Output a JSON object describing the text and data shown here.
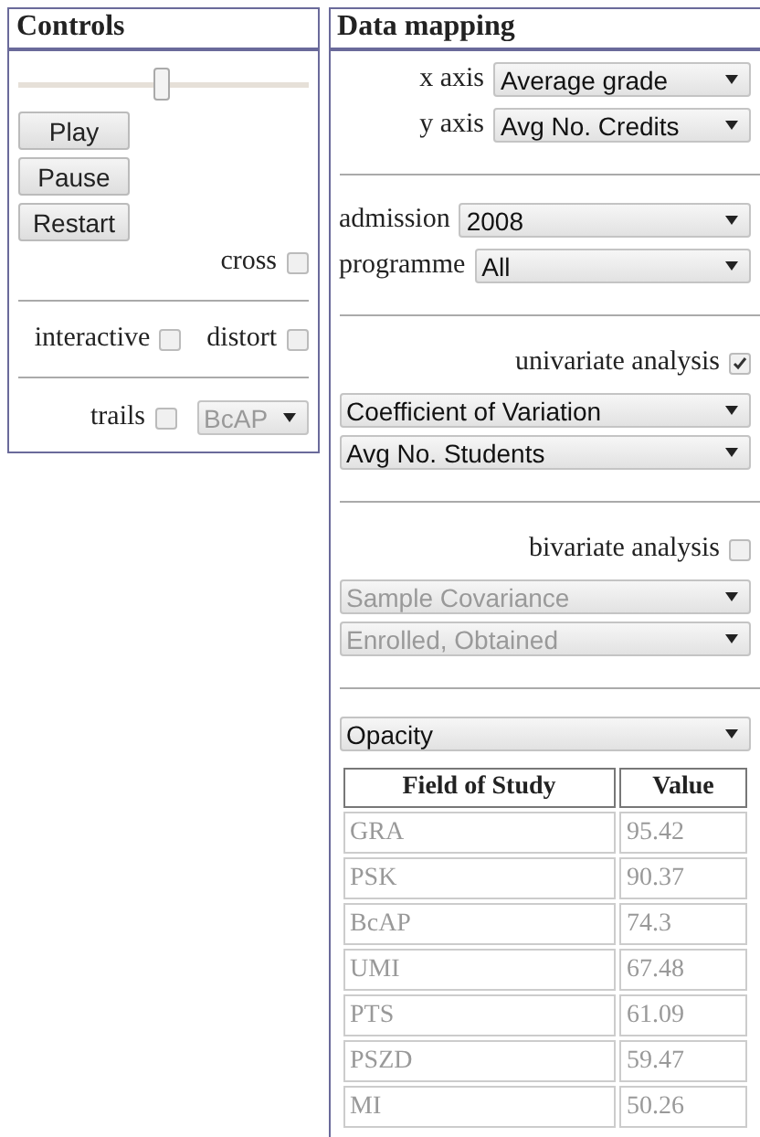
{
  "controls": {
    "title": "Controls",
    "slider": {
      "level": 0.5
    },
    "buttons": [
      "Play",
      "Pause",
      "Restart"
    ],
    "cross": {
      "label": "cross",
      "checked": false
    },
    "interactive": {
      "label": "interactive",
      "checked": false
    },
    "distort": {
      "label": "distort",
      "checked": false
    },
    "trails": {
      "label": "trails",
      "checked": false
    },
    "trails_select": {
      "value": "BcAP",
      "disabled": true
    }
  },
  "mapping": {
    "title": "Data mapping",
    "axes": [
      {
        "label": "x axis",
        "value": "Average grade"
      },
      {
        "label": "y axis",
        "value": "Avg No. Credits"
      }
    ],
    "filters": [
      {
        "label": "admission",
        "value": "2008"
      },
      {
        "label": "programme",
        "value": "All"
      }
    ],
    "analyses": [
      {
        "label": "univariate analysis",
        "checked": true,
        "selects": [
          {
            "value": "Coefficient of Variation",
            "disabled": false
          },
          {
            "value": "Avg No. Students",
            "disabled": false
          }
        ]
      },
      {
        "label": "bivariate analysis",
        "checked": false,
        "selects": [
          {
            "value": "Sample Covariance",
            "disabled": true
          },
          {
            "value": "Enrolled, Obtained",
            "disabled": true
          }
        ]
      }
    ],
    "encoding": {
      "value": "Opacity"
    },
    "table": {
      "columns": [
        "Field of Study",
        "Value"
      ],
      "rows": [
        [
          "GRA",
          "95.42"
        ],
        [
          "PSK",
          "90.37"
        ],
        [
          "BcAP",
          "74.3"
        ],
        [
          "UMI",
          "67.48"
        ],
        [
          "PTS",
          "61.09"
        ],
        [
          "PSZD",
          "59.47"
        ],
        [
          "MI",
          "50.26"
        ]
      ]
    }
  }
}
